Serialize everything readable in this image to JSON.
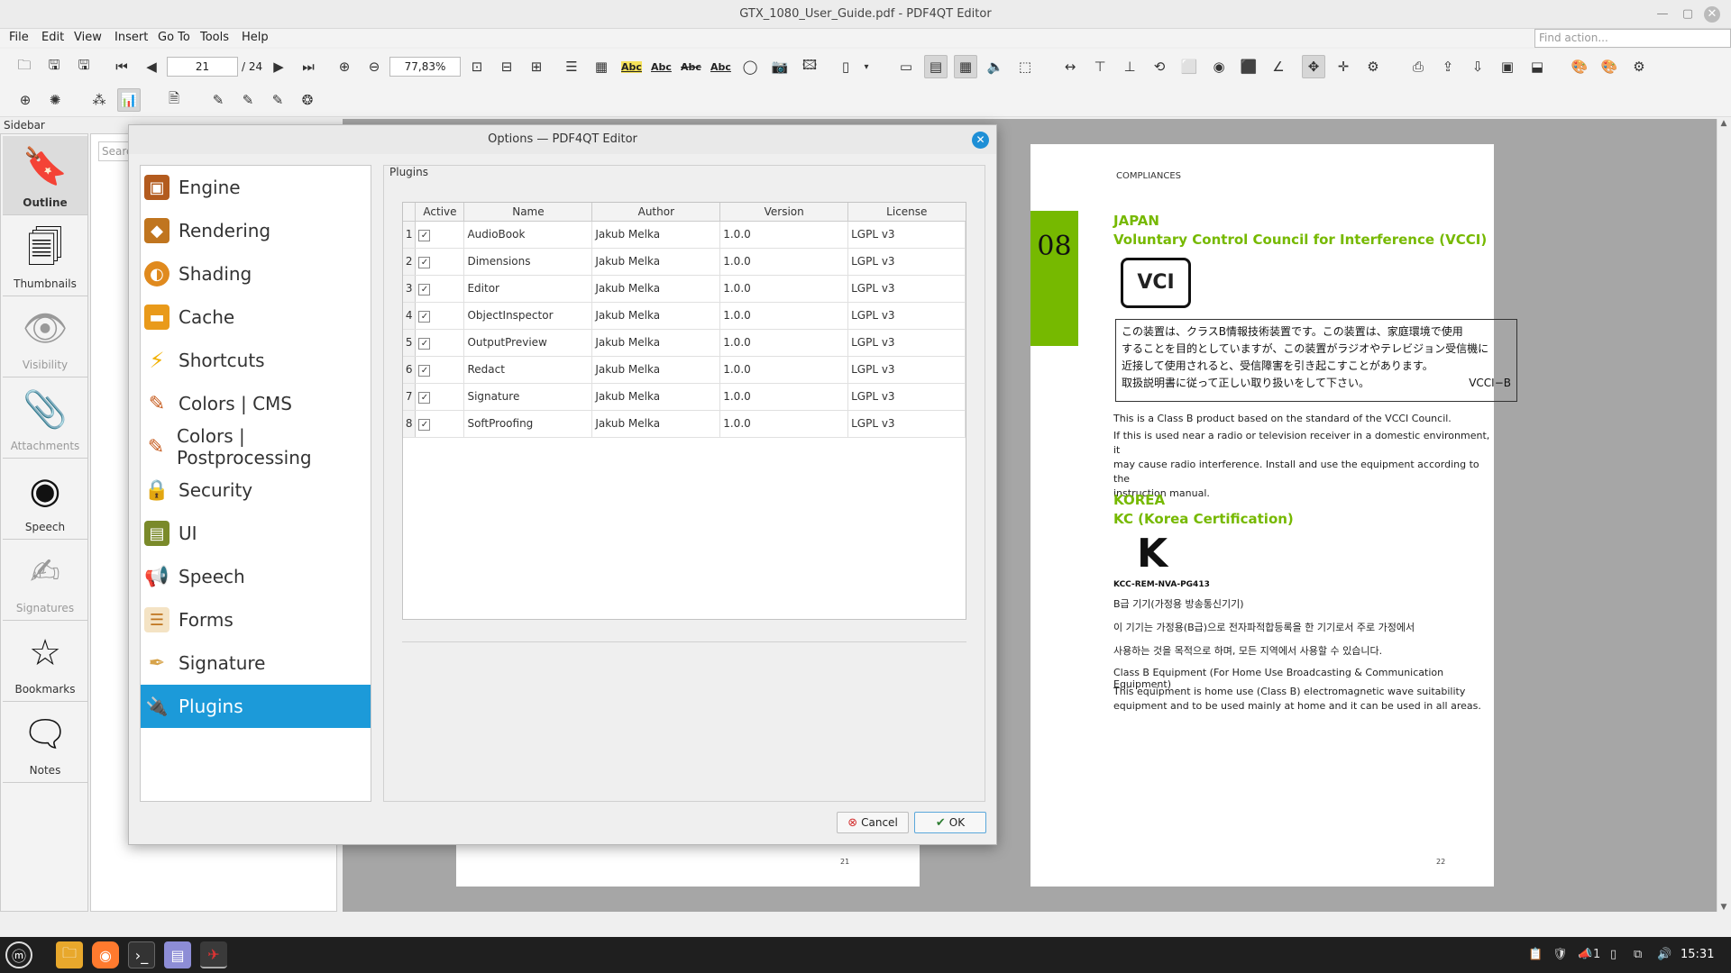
{
  "window": {
    "title": "GTX_1080_User_Guide.pdf - PDF4QT Editor"
  },
  "menubar": {
    "items": [
      {
        "label": "File"
      },
      {
        "label": "Edit"
      },
      {
        "label": "View"
      },
      {
        "label": "Insert"
      },
      {
        "label": "Go To"
      },
      {
        "label": "Tools"
      },
      {
        "label": "Help"
      }
    ],
    "find_action_placeholder": "Find action..."
  },
  "toolbar": {
    "page_number": "21",
    "page_total": "/ 24",
    "zoom": "77,83%",
    "text_tools": [
      "Abc",
      "Abc",
      "Abc",
      "Abc"
    ]
  },
  "sidebar": {
    "header": "Sidebar",
    "search_placeholder": "Search",
    "buttons": [
      {
        "label": "Outline",
        "icon": "bookmark-icon"
      },
      {
        "label": "Thumbnails",
        "icon": "thumbnails-icon"
      },
      {
        "label": "Visibility",
        "icon": "eye-icon"
      },
      {
        "label": "Attachments",
        "icon": "paperclip-icon"
      },
      {
        "label": "Speech",
        "icon": "speech-icon"
      },
      {
        "label": "Signatures",
        "icon": "pen-icon"
      },
      {
        "label": "Bookmarks",
        "icon": "star-icon"
      },
      {
        "label": "Notes",
        "icon": "note-icon"
      }
    ]
  },
  "document": {
    "left_page_number": "21",
    "right_page_number": "22",
    "section_header": "COMPLIANCES",
    "chapter_badge": "08",
    "japan": {
      "heading": "JAPAN",
      "subheading": "Voluntary Control Council for Interference (VCCI)",
      "logo_text": "VCI",
      "jp_line1": "この装置は、クラスB情報技術装置です。この装置は、家庭環境で使用",
      "jp_line2": "することを目的としていますが、この装置がラジオやテレビジョン受信機に",
      "jp_line3": "近接して使用されると、受信障害を引き起こすことがあります。",
      "jp_line4": "取扱説明書に従って正しい取り扱いをして下さい。",
      "jp_code": "VCCI−B",
      "p1": "This is a Class B product based on the standard of the VCCI Council.",
      "p2a": "If this is used near a radio or television receiver in a domestic environment, it",
      "p2b": "may cause radio interference. Install and use the equipment according to the",
      "p2c": "instruction manual."
    },
    "korea": {
      "heading": "KOREA",
      "subheading": "KC (Korea Certification)",
      "cert_code": "KCC-REM-NVA-PG413",
      "kr1": "B급 기기(가정용 방송통신기기)",
      "kr2": "이 기기는 가정용(B급)으로 전자파적합등록을 한 기기로서 주로 가정에서",
      "kr3": "사용하는 것을 목적으로 하며, 모든 지역에서 사용할 수 있습니다.",
      "en1": "Class B Equipment (For Home Use Broadcasting & Communication Equipment)",
      "en2a": "This equipment is home use (Class B) electromagnetic wave suitability",
      "en2b": "equipment and to be used mainly at home and it can be used in all areas."
    }
  },
  "dialog": {
    "title": "Options — PDF4QT Editor",
    "categories": [
      {
        "label": "Engine",
        "icon": "chip-icon",
        "color": "#b35b1e"
      },
      {
        "label": "Rendering",
        "icon": "cube-icon",
        "color": "#c0751f"
      },
      {
        "label": "Shading",
        "icon": "shading-icon",
        "color": "#e08a1e"
      },
      {
        "label": "Cache",
        "icon": "drive-icon",
        "color": "#e99a1a"
      },
      {
        "label": "Shortcuts",
        "icon": "lightning-icon",
        "color": "#f2b100"
      },
      {
        "label": "Colors | CMS",
        "icon": "palette-icon",
        "color": "#c65a1c"
      },
      {
        "label": "Colors | Postprocessing",
        "icon": "palette-icon",
        "color": "#c65a1c"
      },
      {
        "label": "Security",
        "icon": "lock-icon",
        "color": "#9a6a2a"
      },
      {
        "label": "UI",
        "icon": "ui-icon",
        "color": "#7a8a2a"
      },
      {
        "label": "Speech",
        "icon": "megaphone-icon",
        "color": "#e08a1e"
      },
      {
        "label": "Forms",
        "icon": "form-icon",
        "color": "#c0751f"
      },
      {
        "label": "Signature",
        "icon": "signature-pen-icon",
        "color": "#d7a34a"
      },
      {
        "label": "Plugins",
        "icon": "plug-icon",
        "color": "#6a8a3a"
      }
    ],
    "selected_category": "Plugins",
    "panel_title": "Plugins",
    "columns": [
      "Active",
      "Name",
      "Author",
      "Version",
      "License"
    ],
    "plugins": [
      {
        "index": "1",
        "active": "✓",
        "name": "AudioBook",
        "author": "Jakub Melka",
        "version": "1.0.0",
        "license": "LGPL v3"
      },
      {
        "index": "2",
        "active": "✓",
        "name": "Dimensions",
        "author": "Jakub Melka",
        "version": "1.0.0",
        "license": "LGPL v3"
      },
      {
        "index": "3",
        "active": "✓",
        "name": "Editor",
        "author": "Jakub Melka",
        "version": "1.0.0",
        "license": "LGPL v3"
      },
      {
        "index": "4",
        "active": "✓",
        "name": "ObjectInspector",
        "author": "Jakub Melka",
        "version": "1.0.0",
        "license": "LGPL v3"
      },
      {
        "index": "5",
        "active": "✓",
        "name": "OutputPreview",
        "author": "Jakub Melka",
        "version": "1.0.0",
        "license": "LGPL v3"
      },
      {
        "index": "6",
        "active": "✓",
        "name": "Redact",
        "author": "Jakub Melka",
        "version": "1.0.0",
        "license": "LGPL v3"
      },
      {
        "index": "7",
        "active": "✓",
        "name": "Signature",
        "author": "Jakub Melka",
        "version": "1.0.0",
        "license": "LGPL v3"
      },
      {
        "index": "8",
        "active": "✓",
        "name": "SoftProofing",
        "author": "Jakub Melka",
        "version": "1.0.0",
        "license": "LGPL v3"
      }
    ],
    "cancel_label": "Cancel",
    "ok_label": "OK"
  },
  "taskbar": {
    "clock": "15:31",
    "notification_count": "1"
  },
  "colors": {
    "accent": "#1c9ad9",
    "chapter_green": "#76b900",
    "compliance_green": "#76b900"
  }
}
